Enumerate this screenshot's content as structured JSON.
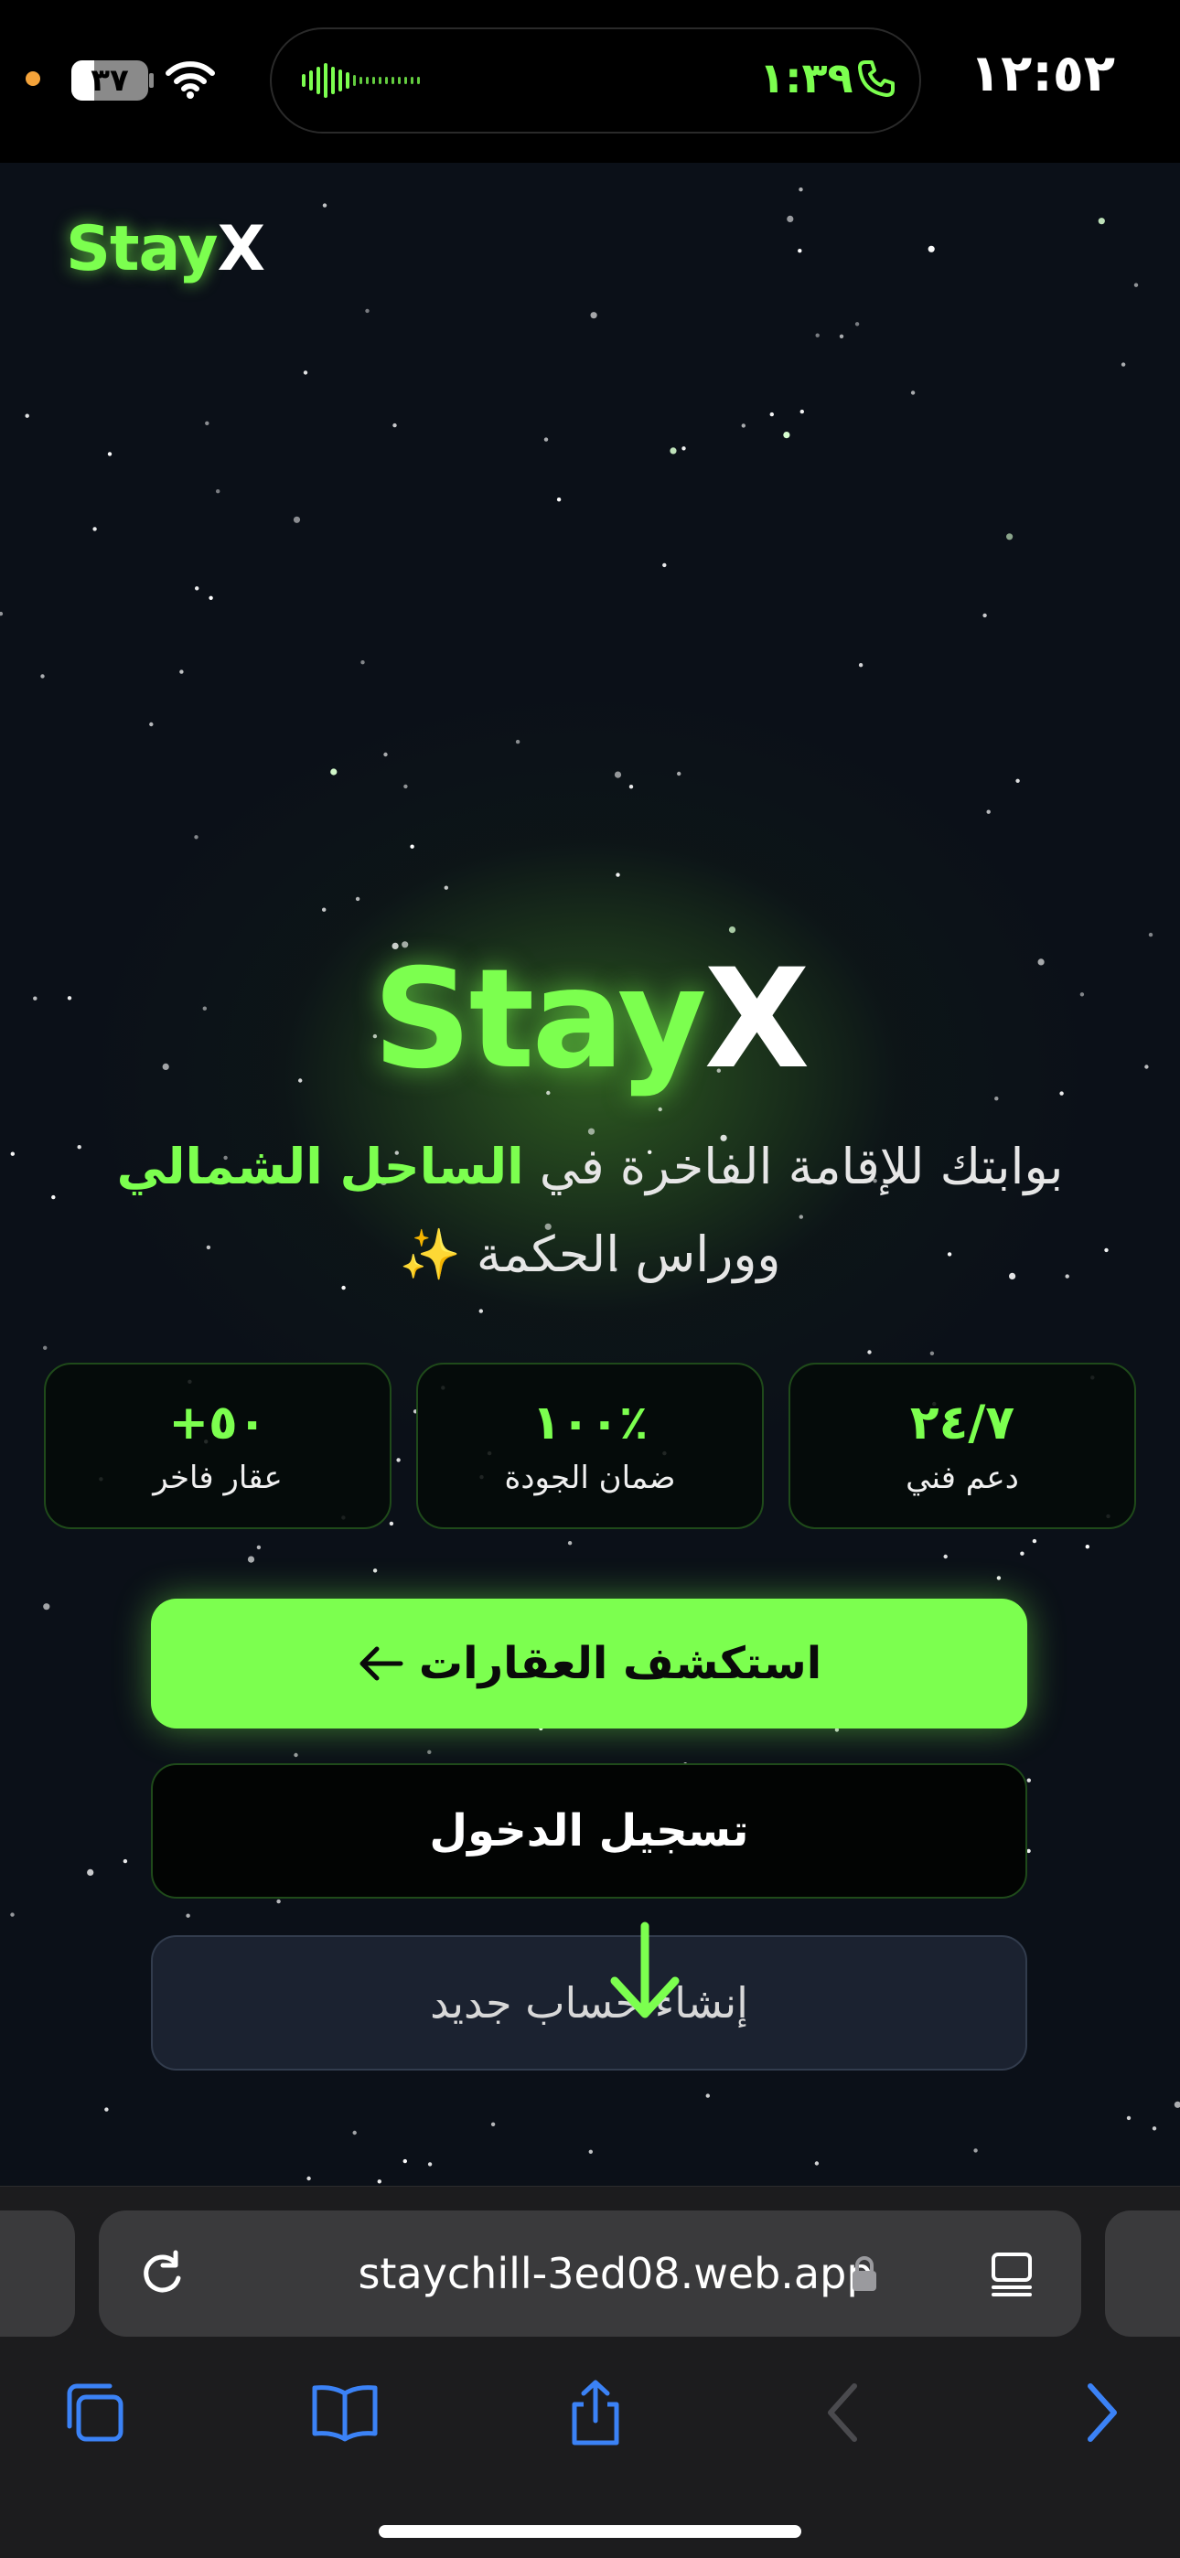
{
  "status_bar": {
    "time": "١٢:٥٢",
    "call_timer": "١:٣٩",
    "battery_level": "٣٧",
    "colors": {
      "accent": "#7cff4f",
      "privacy_dot": "#f4a33a"
    }
  },
  "header": {
    "logo_part1": "Stay",
    "logo_part2": "X"
  },
  "hero": {
    "title_part1": "Stay",
    "title_part2": "X",
    "tagline_before": "بوابتك للإقامة الفاخرة في ",
    "tagline_highlight": "الساحل الشمالي",
    "tagline_after": " ووراس الحكمة ✨"
  },
  "stats": [
    {
      "value": "٢٤/٧",
      "label": "دعم فني"
    },
    {
      "value": "١٠٠٪",
      "label": "ضمان الجودة"
    },
    {
      "value": "+٥٠",
      "label": "عقار فاخر"
    }
  ],
  "actions": {
    "explore_label": "استكشف العقارات",
    "login_label": "تسجيل الدخول",
    "signup_label": "إنشاء حساب جديد"
  },
  "browser": {
    "url": "staychill-3ed08.web.app",
    "icons": [
      "reload-icon",
      "lock-icon",
      "reader-icon",
      "tabs-icon",
      "bookmarks-icon",
      "share-icon",
      "back-icon",
      "forward-icon"
    ]
  },
  "theme": {
    "accent": "#7cff4f",
    "background": "#0b1018",
    "toolbar_blue": "#3b82f6"
  }
}
